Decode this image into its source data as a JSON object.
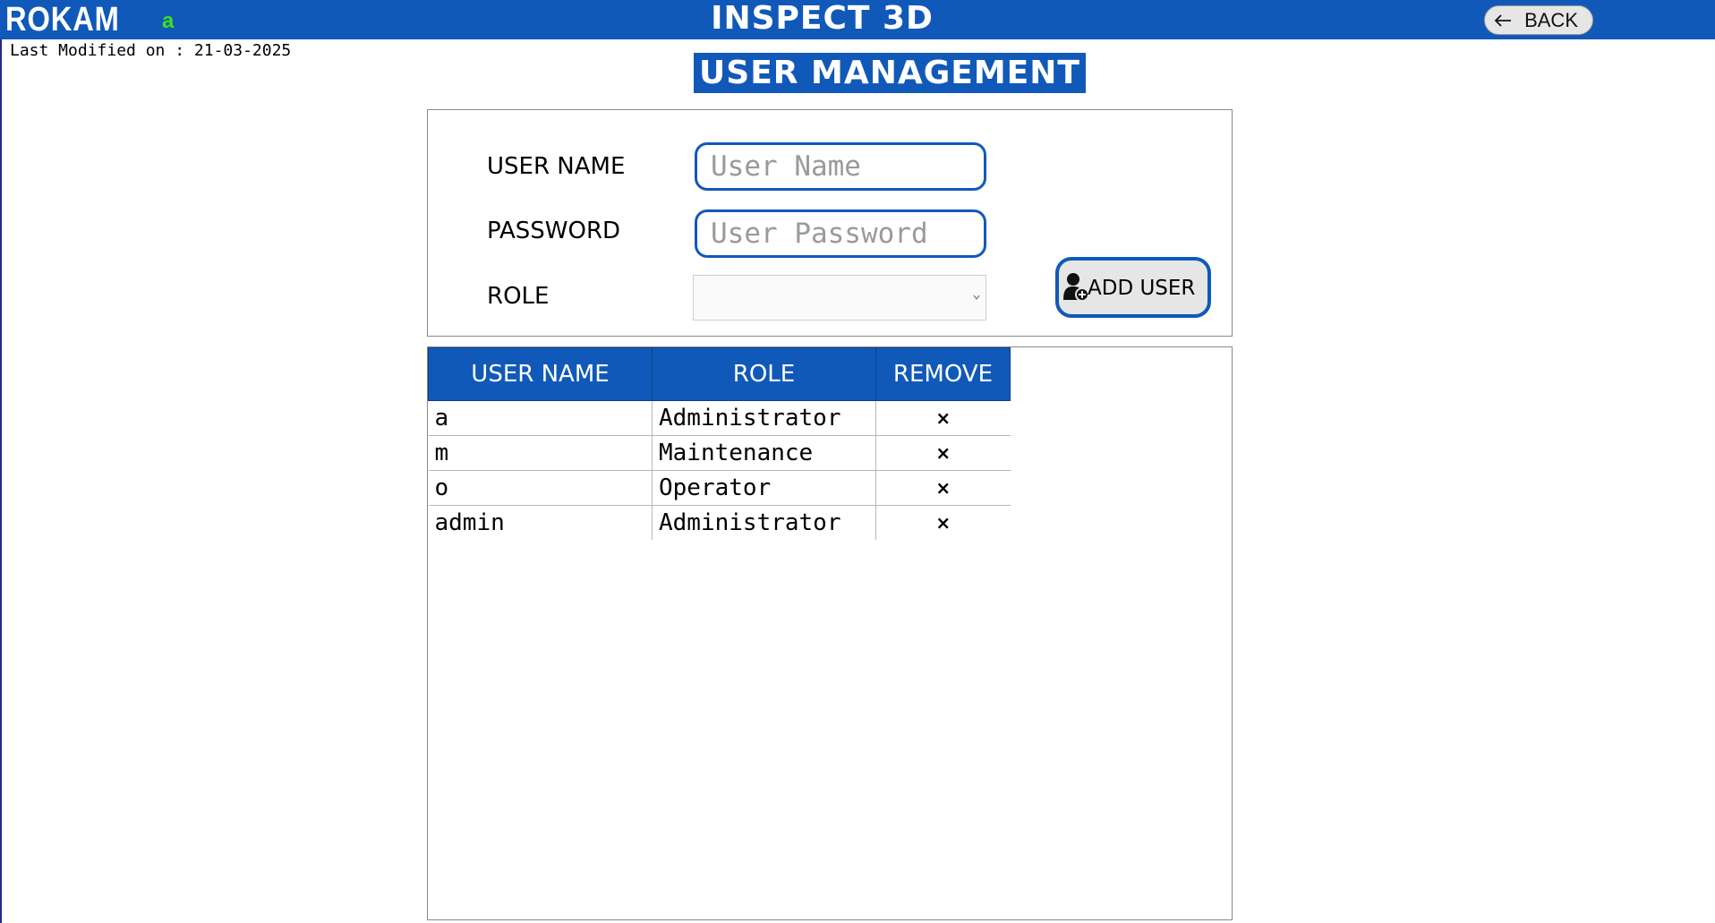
{
  "header": {
    "brand": "ROKAM",
    "current_user": "a",
    "app_title": "INSPECT 3D",
    "back_label": "BACK"
  },
  "last_modified": "Last Modified on : 21-03-2025",
  "page_title": "USER MANAGEMENT",
  "form": {
    "username_label": "USER NAME",
    "username_placeholder": "User Name",
    "username_value": "",
    "password_label": "PASSWORD",
    "password_placeholder": "User Password",
    "password_value": "",
    "role_label": "ROLE",
    "role_value": "",
    "add_user_label": "ADD USER"
  },
  "table": {
    "headers": [
      "USER NAME",
      "ROLE",
      "REMOVE"
    ],
    "rows": [
      {
        "user": "a",
        "role": "Administrator",
        "remove": "×"
      },
      {
        "user": "m",
        "role": "Maintenance",
        "remove": "×"
      },
      {
        "user": "o",
        "role": "Operator",
        "remove": "×"
      },
      {
        "user": "admin",
        "role": "Administrator",
        "remove": "×"
      }
    ]
  },
  "colors": {
    "primary_blue": "#1159b8",
    "user_indicator_green": "#3ee01a",
    "button_gray": "#e6e6e6"
  },
  "icons": {
    "back": "arrow-left-icon",
    "add_user": "add-user-icon",
    "role_dropdown": "chevron-down-icon",
    "remove": "close-icon"
  }
}
